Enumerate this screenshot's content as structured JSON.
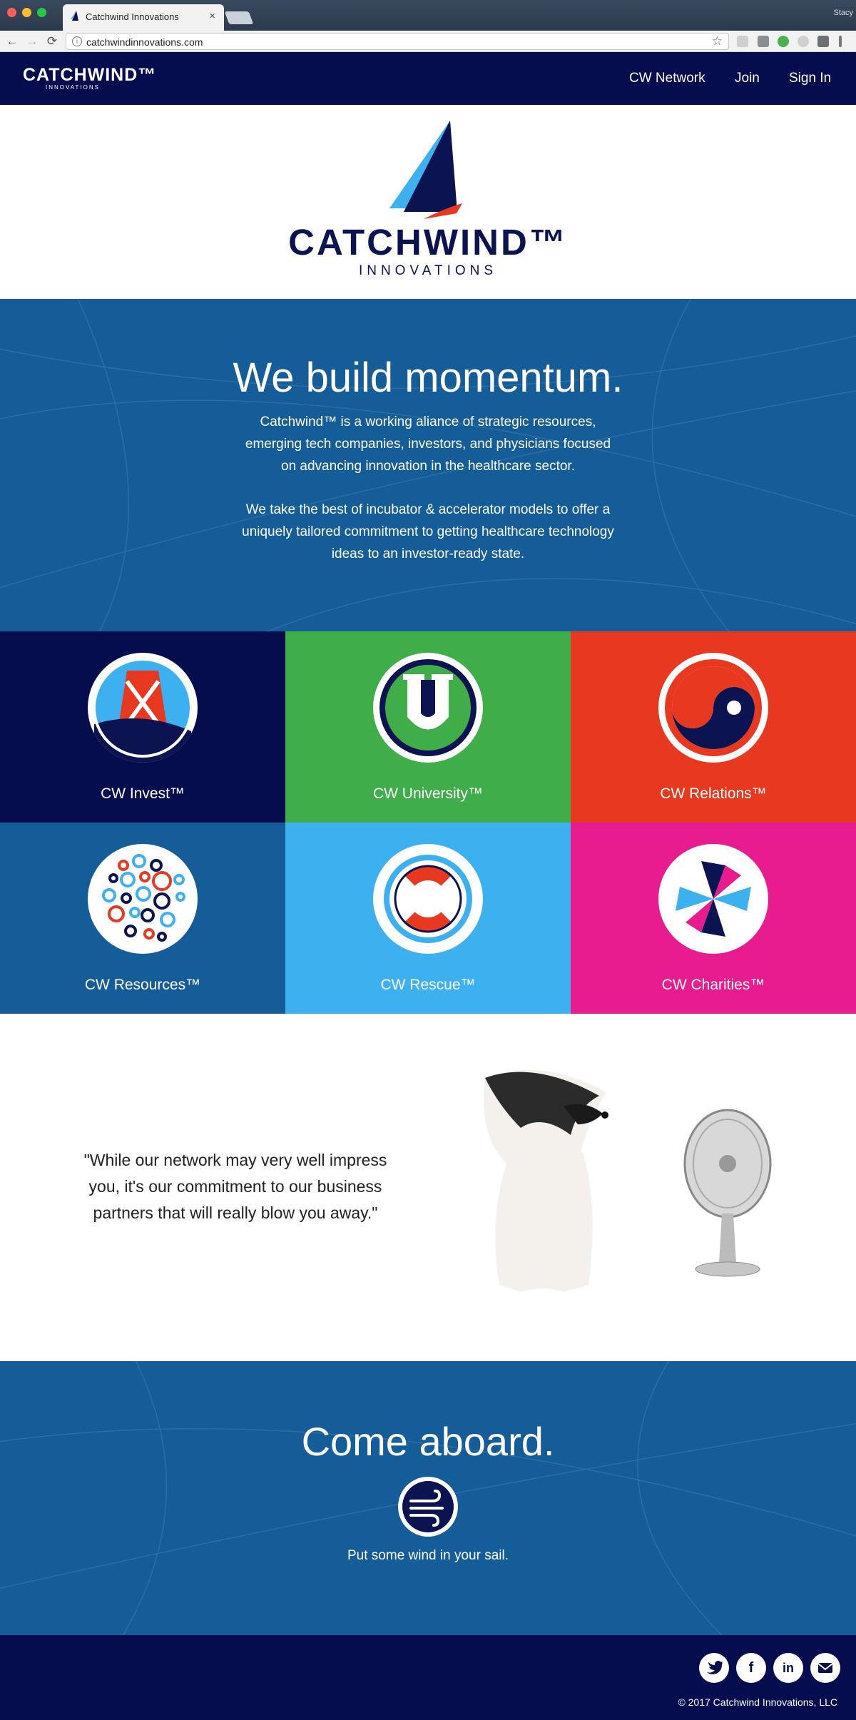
{
  "browser": {
    "tab_title": "Catchwind Innovations",
    "tab_close": "×",
    "url": "catchwindinnovations.com",
    "profile": "Stacy",
    "back": "←",
    "forward": "→",
    "reload": "⟳",
    "info": "i",
    "star": "☆"
  },
  "header": {
    "logo_main": "CATCHWIND™",
    "logo_sub": "INNOVATIONS",
    "nav": [
      "CW Network",
      "Join",
      "Sign In"
    ]
  },
  "brand": {
    "name": "CATCHWIND™",
    "sub": "INNOVATIONS"
  },
  "hero": {
    "title": "We build momentum.",
    "p1_l1": "Catchwind™ is a working aliance of strategic resources,",
    "p1_l2": "emerging tech companies, investors, and physicians focused",
    "p1_l3": "on advancing innovation in the healthcare sector.",
    "p2_l1": "We take the best of incubator & accelerator models to offer a",
    "p2_l2": "uniquely tailored commitment to getting healthcare technology",
    "p2_l3": "ideas to an investor-ready state."
  },
  "tiles": [
    {
      "label": "CW Invest™",
      "color": "#060d4f"
    },
    {
      "label": "CW University™",
      "color": "#3fae49"
    },
    {
      "label": "CW Relations™",
      "color": "#e8381f"
    },
    {
      "label": "CW Resources™",
      "color": "#155d98"
    },
    {
      "label": "CW Rescue™",
      "color": "#3db1f0"
    },
    {
      "label": "CW Charities™",
      "color": "#e81c8e"
    }
  ],
  "quote": {
    "l1": "\"While our network may very well impress",
    "l2": "you, it's our commitment to our business",
    "l3": "partners that will really blow you away.\""
  },
  "aboard": {
    "title": "Come aboard.",
    "sub": "Put some wind in your sail."
  },
  "footer": {
    "social": [
      "twitter-icon",
      "facebook-icon",
      "linkedin-icon",
      "email-icon"
    ],
    "facebook_glyph": "f",
    "linkedin_glyph": "in",
    "copyright": "© 2017 Catchwind Innovations, LLC"
  },
  "colors": {
    "navy": "#060d4f",
    "blue": "#155d98",
    "light_blue": "#3db1f0",
    "red": "#e8381f"
  }
}
